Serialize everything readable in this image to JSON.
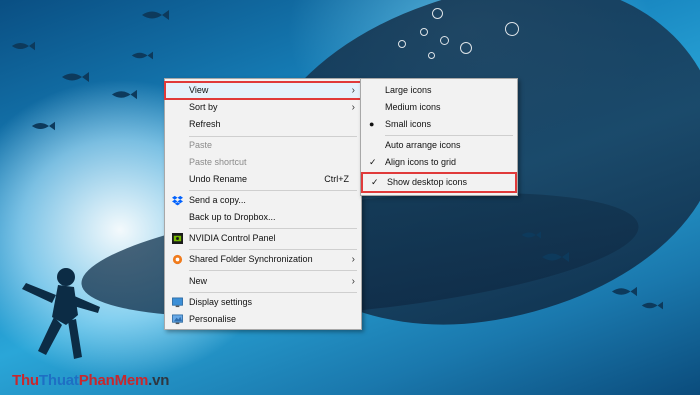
{
  "context_menu": {
    "items": [
      {
        "label": "View",
        "submenu": true
      },
      {
        "label": "Sort by",
        "submenu": true
      },
      {
        "label": "Refresh"
      },
      {
        "label": "Paste",
        "disabled": true
      },
      {
        "label": "Paste shortcut",
        "disabled": true
      },
      {
        "label": "Undo Rename",
        "shortcut": "Ctrl+Z"
      },
      {
        "label": "Send a copy...",
        "icon": "dropbox-icon"
      },
      {
        "label": "Back up to Dropbox..."
      },
      {
        "label": "NVIDIA Control Panel",
        "icon": "nvidia-icon"
      },
      {
        "label": "Shared Folder Synchronization",
        "icon": "sync-icon",
        "submenu": true
      },
      {
        "label": "New",
        "submenu": true
      },
      {
        "label": "Display settings",
        "icon": "display-icon"
      },
      {
        "label": "Personalise",
        "icon": "personalise-icon"
      }
    ]
  },
  "view_submenu": {
    "items": [
      {
        "label": "Large icons"
      },
      {
        "label": "Medium icons"
      },
      {
        "label": "Small icons",
        "mark": "●"
      },
      {
        "label": "Auto arrange icons"
      },
      {
        "label": "Align icons to grid",
        "mark": "✓"
      },
      {
        "label": "Show desktop icons",
        "mark": "✓"
      }
    ]
  },
  "watermark": {
    "part1": "Thu",
    "part2": "Thuat",
    "part3": "PhanMem",
    "part4": ".vn"
  },
  "colors": {
    "highlight_border": "#e03a3a",
    "menu_bg": "#f2f2f2"
  }
}
